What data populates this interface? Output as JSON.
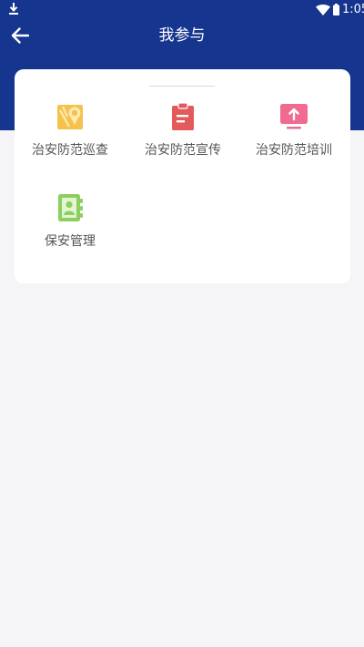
{
  "status_bar": {
    "time": "1:05",
    "icons": [
      "download-icon",
      "wifi-icon",
      "battery-icon"
    ]
  },
  "header": {
    "title": "我参与",
    "back_icon": "arrow-left-icon",
    "background_color": "#15358f"
  },
  "menu": {
    "items": [
      {
        "label": "治安防范巡查",
        "icon": "map-pin-icon",
        "color": "#f5c24b"
      },
      {
        "label": "治安防范宣传",
        "icon": "clipboard-icon",
        "color": "#e25a5a"
      },
      {
        "label": "治安防范培训",
        "icon": "monitor-upload-icon",
        "color": "#f06b8f"
      },
      {
        "label": "保安管理",
        "icon": "contact-book-icon",
        "color": "#8ccf5f"
      }
    ]
  }
}
